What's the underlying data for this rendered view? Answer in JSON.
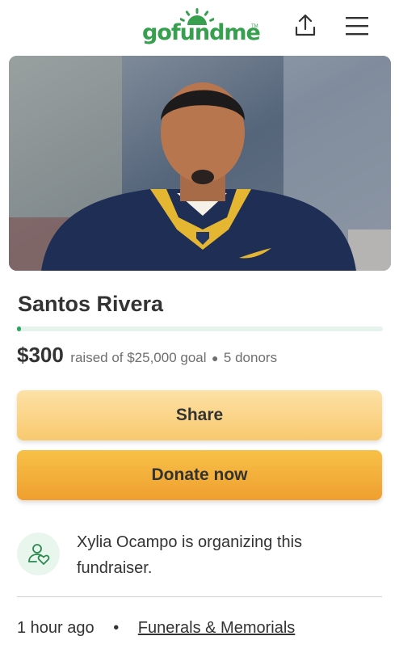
{
  "header": {
    "logo_text": "gofundme",
    "logo_tm": "TM",
    "share_icon": "share-upload-icon",
    "menu_icon": "hamburger-menu-icon"
  },
  "hero": {
    "image_description": "football player in navy jersey with gold collar, stadium crowd background"
  },
  "campaign": {
    "title": "Santos Rivera",
    "progress_fraction": 0.012,
    "raised": "$300",
    "goal_text": "raised of $25,000 goal",
    "separator": "●",
    "donors": "5 donors"
  },
  "actions": {
    "share_label": "Share",
    "donate_label": "Donate now"
  },
  "organizer": {
    "icon": "heart-person-icon",
    "text": "Xylia Ocampo is organizing this fundraiser."
  },
  "meta": {
    "time": "1 hour ago",
    "separator": "•",
    "category": "Funerals & Memorials"
  },
  "colors": {
    "brand_green": "#37a04e",
    "progress_green": "#2aa861",
    "share_button": "#f8c96e",
    "donate_button": "#ef9f2f"
  }
}
